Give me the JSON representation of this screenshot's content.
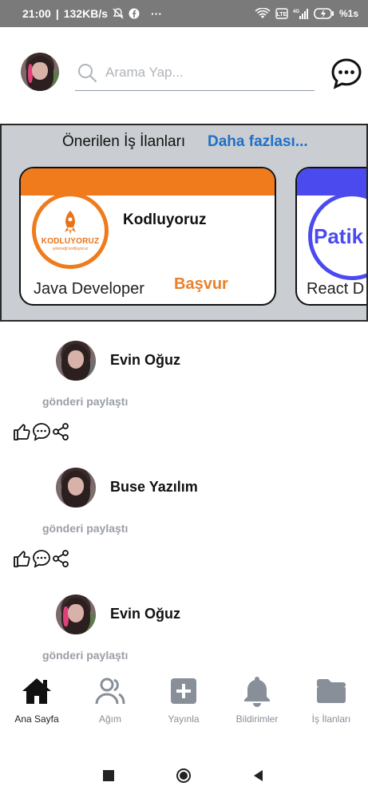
{
  "status_bar": {
    "time": "21:00",
    "speed": "132KB/s",
    "more": "···",
    "battery": "%1s"
  },
  "header": {
    "search_placeholder": "Arama Yap..."
  },
  "jobs": {
    "title": "Önerilen İş İlanları",
    "more_link": "Daha fazlası...",
    "cards": [
      {
        "company": "Kodluyoruz",
        "logo_text": "KODLUYORUZ",
        "logo_sub": "yeteneği kodluyoruz",
        "position": "Java Developer",
        "apply_label": "Başvur",
        "band_color": "#f07b1c"
      },
      {
        "company": "",
        "logo_text": "Patik",
        "position": "React D",
        "band_color": "#4a4aef"
      }
    ]
  },
  "feed": {
    "posts": [
      {
        "author": "Evin Oğuz",
        "text": "gönderi paylaştı"
      },
      {
        "author": "Buse Yazılım",
        "text": "gönderi paylaştı"
      },
      {
        "author": "Evin Oğuz",
        "text": "gönderi paylaştı"
      }
    ]
  },
  "bottom_nav": {
    "items": [
      {
        "label": "Ana Sayfa",
        "icon": "home-icon",
        "active": true
      },
      {
        "label": "Ağım",
        "icon": "people-icon",
        "active": false
      },
      {
        "label": "Yayınla",
        "icon": "plus-square-icon",
        "active": false
      },
      {
        "label": "Bildirimler",
        "icon": "bell-icon",
        "active": false
      },
      {
        "label": "İş İlanları",
        "icon": "folder-icon",
        "active": false
      }
    ]
  },
  "colors": {
    "accent": "#1f6fc9",
    "orange": "#f07b1c",
    "nav_inactive": "#888f98",
    "jobs_bg": "#cacdd1"
  }
}
